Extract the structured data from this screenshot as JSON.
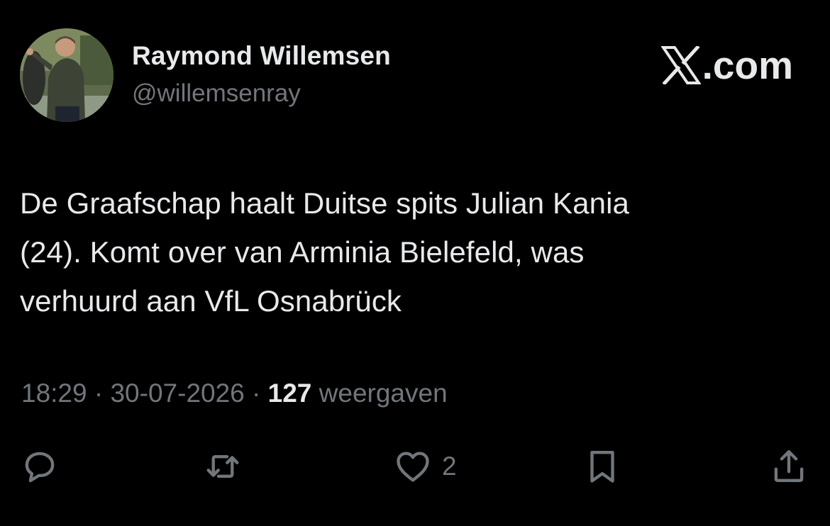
{
  "author": {
    "name": "Raymond Willemsen",
    "handle": "@willemsenray"
  },
  "brand": {
    "label": ".com",
    "icon": "x-logo-icon"
  },
  "tweet": {
    "lines": [
      "De Graafschap haalt Duitse spits Julian Kania",
      "(24). Komt over van Arminia Bielefeld, was",
      "verhuurd aan VfL Osnabrück"
    ]
  },
  "meta": {
    "time": "18:29",
    "separator": "·",
    "date": "30-07-2026",
    "views_count": "127",
    "views_label": "weergaven"
  },
  "actions": {
    "reply": {
      "icon": "reply-icon"
    },
    "repost": {
      "icon": "repost-icon"
    },
    "like": {
      "icon": "heart-icon",
      "count": "2"
    },
    "bookmark": {
      "icon": "bookmark-icon"
    },
    "share": {
      "icon": "share-icon"
    }
  },
  "colors": {
    "background": "#000000",
    "primary_text": "#e7e9ea",
    "secondary_text": "#71767b"
  }
}
